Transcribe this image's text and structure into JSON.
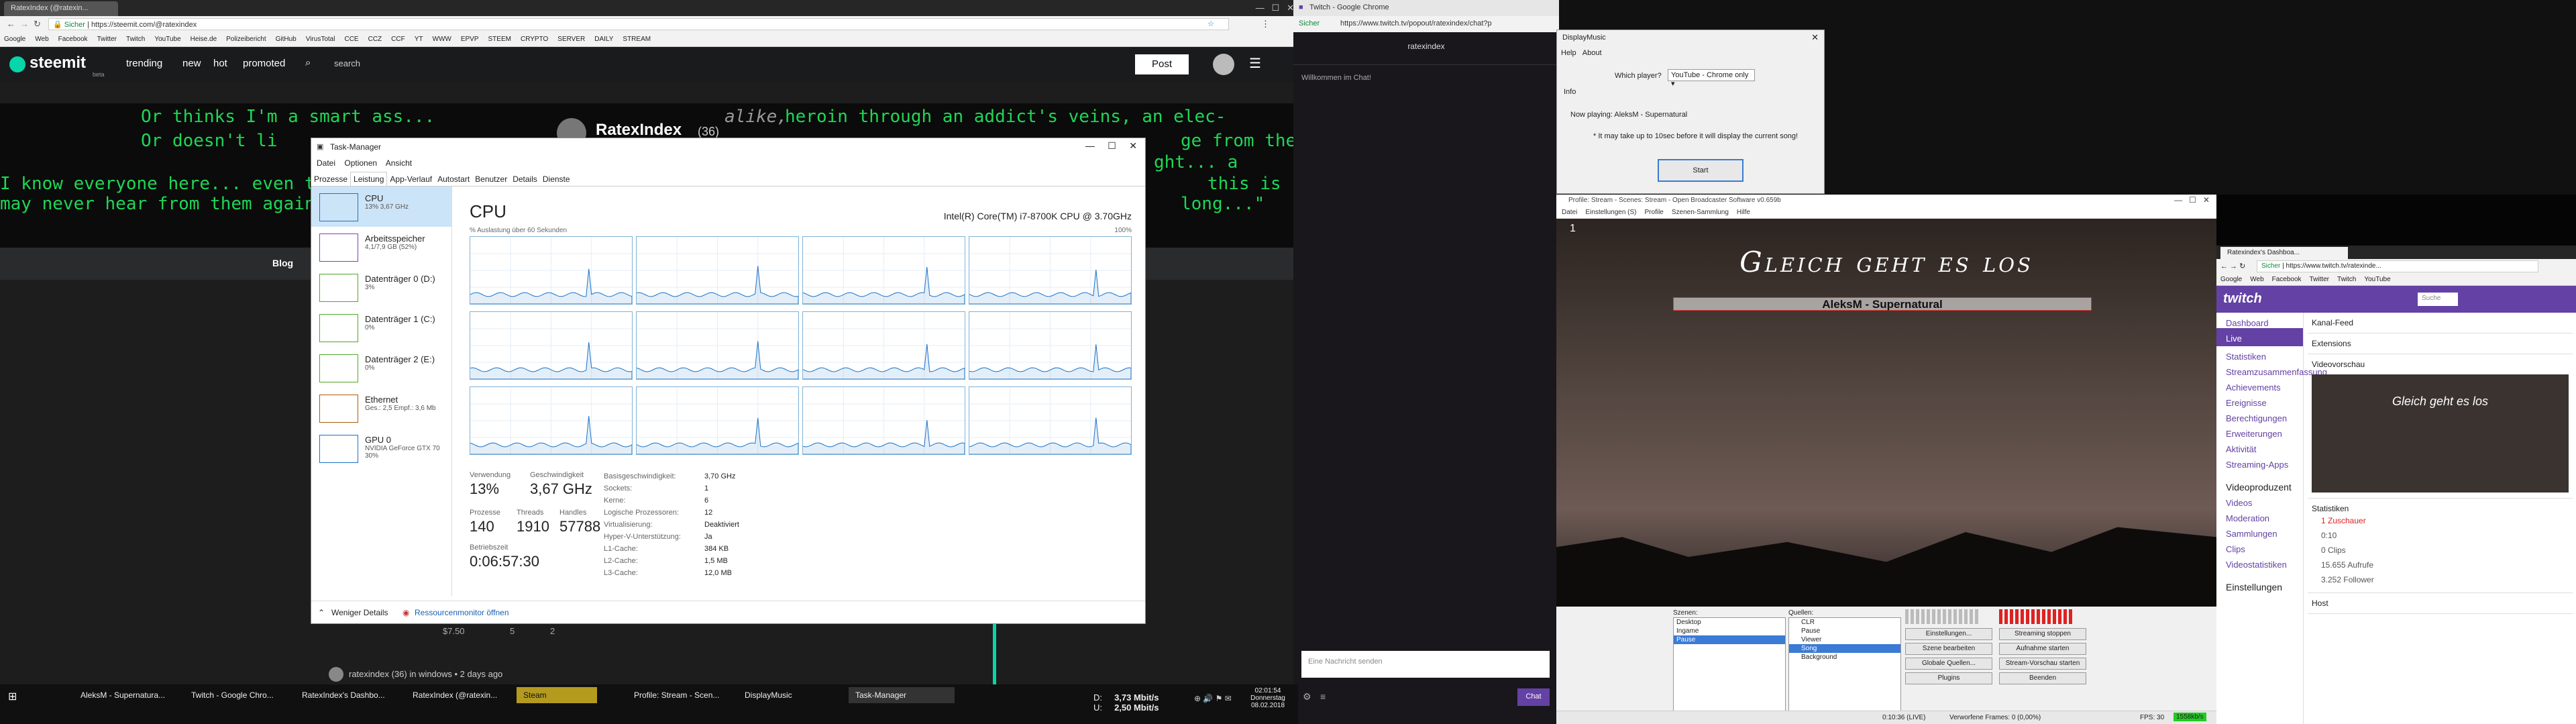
{
  "chrome": {
    "tabs": [
      "RatexIndex (@ratexin...",
      "Twitch - Google Chrome"
    ],
    "secure": "Sicher",
    "url": "https://steemit.com/@ratexindex",
    "bookmarks": [
      "Google",
      "Web",
      "Facebook",
      "Twitter",
      "Twitch",
      "YouTube",
      "Heise.de",
      "Polizeibericht",
      "GitHub",
      "VirusTotal",
      "CCE",
      "CCZ",
      "CCF",
      "YT",
      "WWW",
      "EPVP",
      "STEEM",
      "CRYPTO",
      "SERVER",
      "DAILY",
      "STREAM"
    ]
  },
  "steemit": {
    "logo": "steemit",
    "logo_sub": "beta",
    "nav": [
      "trending",
      "new",
      "hot",
      "promoted"
    ],
    "search": "search",
    "post": "Post",
    "profile_name": "RatexIndex",
    "profile_rep": "(36)",
    "matrix_lines": [
      "Or thinks I'm a smart ass...",
      "Or doesn't li",
      "I know everyone here... even t",
      "may never hear from them again"
    ],
    "matrix_right": [
      "heroin through an addict's veins, an elec-",
      "ge from the",
      "ght... a",
      "this is",
      "long...\""
    ],
    "matrix_alike": "alike,",
    "blog_tab": "Blog",
    "footer_user": "ratexindex (36) in windows • 2 days ago",
    "footer_value": "$7.50",
    "footer_votes": "5",
    "footer_comments": "2"
  },
  "taskmgr": {
    "title": "Task-Manager",
    "menu": [
      "Datei",
      "Optionen",
      "Ansicht"
    ],
    "tabs": [
      "Prozesse",
      "Leistung",
      "App-Verlauf",
      "Autostart",
      "Benutzer",
      "Details",
      "Dienste"
    ],
    "side": [
      {
        "name": "CPU",
        "sub": "13%  3,67 GHz",
        "color": "#1a73c7"
      },
      {
        "name": "Arbeitsspeicher",
        "sub": "4,1/7,9 GB (52%)",
        "color": "#8b3ab7"
      },
      {
        "name": "Datenträger 0 (D:)",
        "sub": "3%",
        "color": "#4ea82a"
      },
      {
        "name": "Datenträger 1 (C:)",
        "sub": "0%",
        "color": "#4ea82a"
      },
      {
        "name": "Datenträger 2 (E:)",
        "sub": "0%",
        "color": "#4ea82a"
      },
      {
        "name": "Ethernet",
        "sub": "Ges.: 2,5  Empf.: 3,6 Mb",
        "color": "#a75c0a"
      },
      {
        "name": "GPU 0",
        "sub": "NVIDIA GeForce GTX 70",
        "sub2": "30%",
        "color": "#1a73c7"
      }
    ],
    "heading": "CPU",
    "cpu_model": "Intel(R) Core(TM) i7-8700K CPU @ 3.70GHz",
    "graph_label": "% Auslastung über 60 Sekunden",
    "graph_max": "100%",
    "stats": {
      "usage_label": "Verwendung",
      "usage": "13%",
      "speed_label": "Geschwindigkeit",
      "speed": "3,67 GHz",
      "proc_label": "Prozesse",
      "proc": "140",
      "threads_label": "Threads",
      "threads": "1910",
      "handles_label": "Handles",
      "handles": "57788",
      "uptime_label": "Betriebszeit",
      "uptime": "0:06:57:30"
    },
    "details": [
      [
        "Basisgeschwindigkeit:",
        "3,70 GHz"
      ],
      [
        "Sockets:",
        "1"
      ],
      [
        "Kerne:",
        "6"
      ],
      [
        "Logische Prozessoren:",
        "12"
      ],
      [
        "Virtualisierung:",
        "Deaktiviert"
      ],
      [
        "Hyper-V-Unterstützung:",
        "Ja"
      ],
      [
        "L1-Cache:",
        "384 KB"
      ],
      [
        "L2-Cache:",
        "1,5 MB"
      ],
      [
        "L3-Cache:",
        "12,0 MB"
      ]
    ],
    "fewer": "Weniger Details",
    "resmon": "Ressourcenmonitor öffnen"
  },
  "twitch_popout": {
    "title": "Twitch - Google Chrome",
    "secure": "Sicher",
    "url": "https://www.twitch.tv/popout/ratexindex/chat?p",
    "channel": "ratexindex",
    "welcome": "Willkommen im Chat!",
    "placeholder": "Eine Nachricht senden",
    "chat_btn": "Chat"
  },
  "displaymusic": {
    "title": "DisplayMusic",
    "menu": [
      "Help",
      "About"
    ],
    "which": "Which player?",
    "player": "YouTube - Chrome only",
    "info": "Info",
    "playing": "Now playing: AleksM - Supernatural",
    "note": "* It may take up to 10sec before it will display the current song!",
    "start": "Start"
  },
  "obs": {
    "title": "Profile: Stream - Scenes: Stream - Open Broadcaster Software v0.659b",
    "menu": [
      "Datei",
      "Einstellungen (S)",
      "Profile",
      "Szenen-Sammlung",
      "Hilfe"
    ],
    "overlay_title": "Gleich geht es los",
    "song": "AleksM - Supernatural",
    "corner": "1",
    "scenes_label": "Szenen:",
    "scenes": [
      "Desktop",
      "Ingame",
      "Pause"
    ],
    "sources_label": "Quellen:",
    "sources": [
      "CLR",
      "Pause",
      "Viewer",
      "Song",
      "Background"
    ],
    "buttons": [
      "Einstellungen...",
      "Szene bearbeiten",
      "Globale Quellen...",
      "Plugins"
    ],
    "buttons2": [
      "Streaming stoppen",
      "Aufnahme starten",
      "Stream-Vorschau starten",
      "Beenden"
    ],
    "status_time": "0:10:36 (LIVE)",
    "dropped": "Verworfene Frames: 0 (0,00%)",
    "fps": "FPS: 30",
    "bitrate": "1558kb/s"
  },
  "rchrome": {
    "tab": "Ratexindex's Dashboa...",
    "secure": "Sicher",
    "url": "https://www.twitch.tv/ratexinde...",
    "bookmarks": [
      "Google",
      "Web",
      "Facebook",
      "Twitter",
      "Twitch",
      "YouTube"
    ],
    "search": "Suche",
    "nav": [
      "Dashboard",
      "Live",
      "Statistiken",
      "Streamzusammenfassung",
      "Achievements",
      "Ereignisse",
      "Berechtigungen",
      "Erweiterungen",
      "Aktivität",
      "Streaming-Apps"
    ],
    "nav2_head": "Videoproduzent",
    "nav2": [
      "Videos",
      "Moderation",
      "Sammlungen",
      "Clips",
      "Videostatistiken"
    ],
    "nav3_head": "Einstellungen",
    "panels": [
      "Kanal-Feed",
      "Extensions",
      "Videovorschau",
      "Statistiken",
      "Host"
    ],
    "preview_text": "Gleich geht es los",
    "stats": [
      "1 Zuschauer",
      "0:10",
      "0 Clips",
      "15.655 Aufrufe",
      "3.252 Follower"
    ]
  },
  "taskbar": {
    "items": [
      "AleksM - Supernatura...",
      "Twitch - Google Chro...",
      "RatexIndex's Dashbo...",
      "RatexIndex (@ratexin...",
      "Steam",
      "Profile: Stream - Scen...",
      "DisplayMusic",
      "Task-Manager"
    ],
    "net_d": "D:",
    "net_d_val": "3,73 Mbit/s",
    "net_u": "U:",
    "net_u_val": "2,50 Mbit/s",
    "time": "02:01:54",
    "day": "Donnerstag",
    "date": "08.02.2018"
  }
}
